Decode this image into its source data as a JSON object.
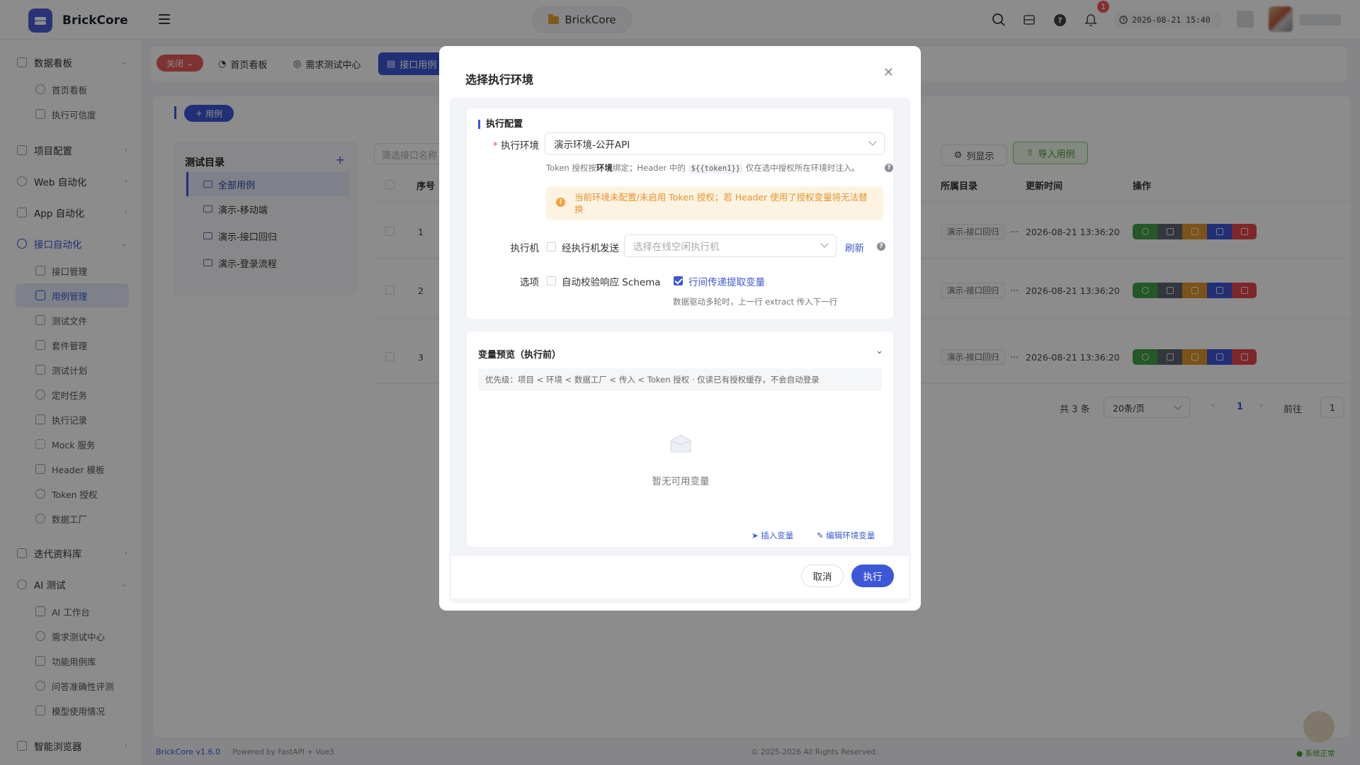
{
  "app": {
    "name": "BrickCore",
    "project": "BrickCore",
    "datetime": "2026-08-21 15:40",
    "notif_count": "1"
  },
  "sidebar": {
    "groups": [
      {
        "label": "数据看板",
        "items": [
          "首页看板",
          "执行可信度"
        ]
      },
      {
        "label": "项目配置"
      },
      {
        "label": "Web 自动化"
      },
      {
        "label": "App 自动化"
      },
      {
        "label": "接口自动化",
        "items": [
          "接口管理",
          "用例管理",
          "测试文件",
          "套件管理",
          "测试计划",
          "定时任务",
          "执行记录",
          "Mock 服务",
          "Header 模板",
          "Token 授权",
          "数据工厂"
        ]
      },
      {
        "label": "迭代资料库"
      },
      {
        "label": "AI 测试",
        "items": [
          "AI 工作台",
          "需求测试中心",
          "功能用例库",
          "问答准确性评测",
          "模型使用情况"
        ]
      },
      {
        "label": "智能浏览器"
      }
    ]
  },
  "tabs": {
    "close_label": "关闭",
    "items": [
      "首页看板",
      "需求测试中心",
      "接口用例"
    ]
  },
  "content": {
    "add_label": "用例",
    "tree_title": "测试目录",
    "tree": [
      "全部用例",
      "演示-移动端",
      "演示-接口回归",
      "演示-登录流程"
    ],
    "filter_placeholder": "筛选接口名称",
    "col_display": "列显示",
    "import_label": "导入用例",
    "headers": {
      "index": "序号",
      "dir": "所属目录",
      "updated": "更新时间",
      "ops": "操作"
    },
    "rows": [
      {
        "index": "1",
        "dir": "演示-接口回归",
        "updated": "2026-08-21 13:36:20"
      },
      {
        "index": "2",
        "dir": "演示-接口回归",
        "updated": "2026-08-21 13:36:20"
      },
      {
        "index": "3",
        "dir": "演示-接口回归",
        "updated": "2026-08-21 13:36:20"
      }
    ],
    "ellipsis": "...",
    "pager": {
      "total": "共 3 条",
      "page_size": "20条/页",
      "current": "1",
      "goto": "前往",
      "goto_val": "1"
    }
  },
  "footer": {
    "version": "BrickCore v1.6.0",
    "powered": "Powered by FastAPI + Vue3",
    "copyright": "© 2025-2026 All Rights Reserved.",
    "status": "系统正常"
  },
  "modal": {
    "title": "选择执行环境",
    "exec_section": "执行配置",
    "env_label": "执行环境",
    "env_value": "演示环境-公开API",
    "token_hint_a": "Token 授权按",
    "token_hint_b": "环境",
    "token_hint_c": "绑定；Header 中的",
    "token_code": "${{token1}}",
    "token_hint_d": "仅在选中授权所在环境时注入。",
    "warning": "当前环境未配置/未启用 Token 授权；若 Header 使用了授权变量将无法替换",
    "runner_label": "执行机",
    "runner_check": "经执行机发送",
    "runner_placeholder": "选择在线空闲执行机",
    "refresh": "刷新",
    "options_label": "选项",
    "opt_schema": "自动校验响应 Schema",
    "opt_extract": "行间传递提取变量",
    "opt_hint": "数据驱动多轮时，上一行 extract 传入下一行",
    "var_title": "变量预览（执行前）",
    "priority": "优先级：项目 < 环境 < 数据工厂 < 传入 < Token 授权 · 仅读已有授权缓存，不会自动登录",
    "empty": "暂无可用变量",
    "insert_var": "插入变量",
    "edit_env_var": "编辑环境变量",
    "cancel": "取消",
    "run": "执行"
  },
  "colors": {
    "primary": "#3c57d8",
    "danger": "#e85c5c",
    "success": "#4a9b2c",
    "warning": "#e8912a"
  }
}
